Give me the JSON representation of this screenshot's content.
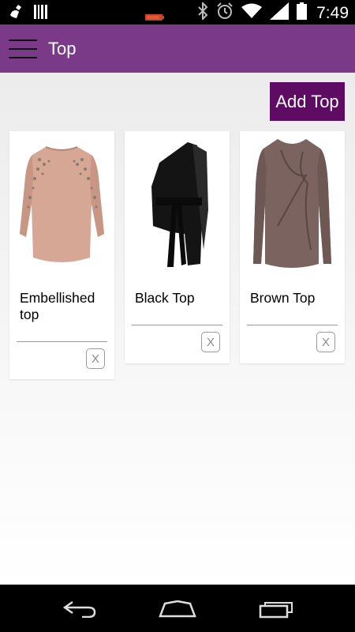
{
  "status_bar": {
    "time": "7:49",
    "icons": [
      "cleaner-icon",
      "barcode-icon",
      "battery-indicator-icon",
      "bluetooth-icon",
      "alarm-icon",
      "wifi-icon",
      "signal-icon",
      "battery-icon"
    ]
  },
  "app_bar": {
    "title": "Top",
    "menu_icon": "hamburger-icon",
    "color": "#7a3a87"
  },
  "add_button": {
    "label": "Add Top",
    "color": "#5e0b63"
  },
  "items": [
    {
      "name": "Embellished top",
      "garment_color": "#d6a795",
      "remove_label": "X"
    },
    {
      "name": "Black Top",
      "garment_color": "#141414",
      "remove_label": "X"
    },
    {
      "name": "Brown Top",
      "garment_color": "#7b6460",
      "remove_label": "X"
    }
  ],
  "nav_bar": {
    "buttons": [
      "back-icon",
      "home-icon",
      "recent-apps-icon"
    ]
  }
}
